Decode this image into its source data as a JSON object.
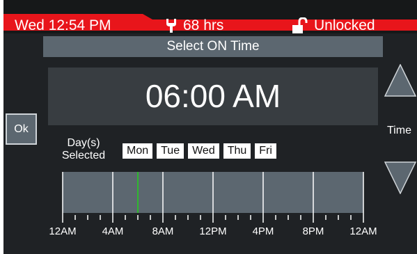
{
  "status": {
    "datetime": "Wed 12:54 PM",
    "hours": "68 hrs",
    "lock_status": "Unlocked",
    "accent_color": "#e8151b"
  },
  "title": "Select ON Time",
  "selected_time": "06:00 AM",
  "ok_label": "Ok",
  "time_label": "Time",
  "days_selected_label": "Day(s) Selected",
  "days": [
    "Mon",
    "Tue",
    "Wed",
    "Thu",
    "Fri"
  ],
  "timeline": {
    "tick_labels": [
      "12AM",
      "4AM",
      "8AM",
      "12PM",
      "4PM",
      "8PM",
      "12AM"
    ],
    "range_hours": [
      0,
      24
    ],
    "marker_hour": 6,
    "marker_color": "#2fb82f"
  },
  "icons": {
    "hours": "wrench-icon",
    "lock": "unlocked-padlock-icon",
    "up": "triangle-up-icon",
    "down": "triangle-down-icon"
  }
}
